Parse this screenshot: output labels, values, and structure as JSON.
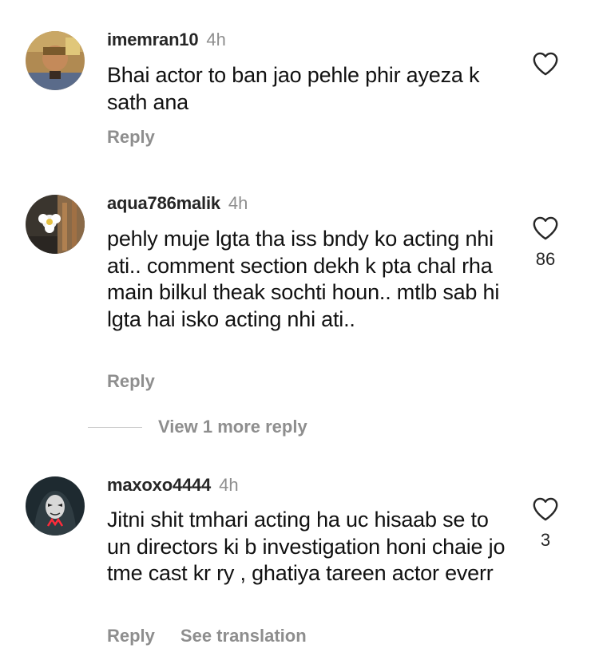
{
  "comments": [
    {
      "username": "imemran10",
      "time": "4h",
      "text": "Bhai actor to ban jao pehle phir ayeza k sath ana",
      "likes": "",
      "actions": {
        "reply": "Reply"
      }
    },
    {
      "username": "aqua786malik",
      "time": "4h",
      "text": "pehly muje lgta tha iss bndy ko acting nhi ati.. comment section dekh k pta chal rha main bilkul theak sochti houn.. mtlb sab hi lgta hai isko acting nhi ati..",
      "likes": "86",
      "actions": {
        "reply": "Reply"
      }
    },
    {
      "username": "maxoxo4444",
      "time": "4h",
      "text": "Jitni shit tmhari acting ha uc hisaab se to un directors ki b investigation honi chaie jo tme cast kr ry , ghatiya tareen actor everr",
      "likes": "3",
      "actions": {
        "reply": "Reply",
        "translate": "See translation"
      }
    }
  ],
  "view_more_replies": "View 1 more reply",
  "icons": {
    "like": "heart-outline-icon"
  },
  "colors": {
    "username": "#262626",
    "secondary": "#8e8e8e",
    "text": "#111111"
  }
}
